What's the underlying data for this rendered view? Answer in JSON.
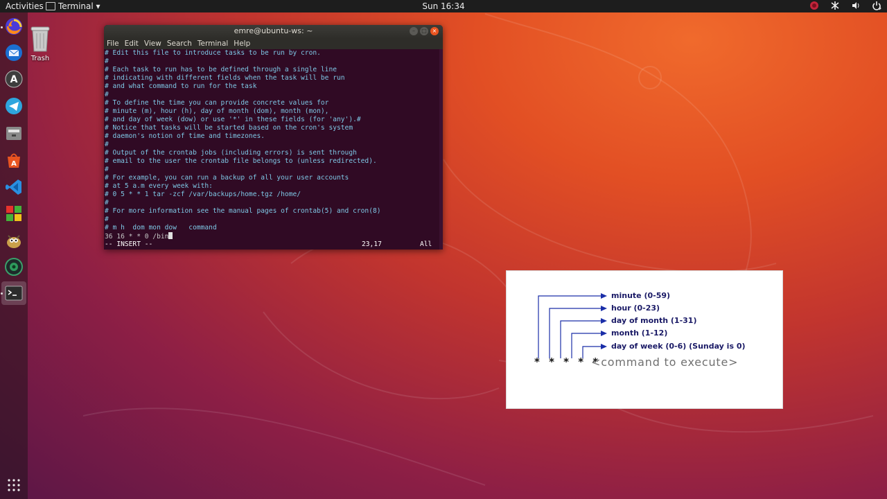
{
  "topbar": {
    "activities": "Activities",
    "app_name": "Terminal ▾",
    "clock": "Sun 16:34",
    "tray_icons": [
      "recording-icon",
      "network-icon",
      "volume-icon",
      "power-icon"
    ]
  },
  "dock": {
    "apps": [
      "firefox-icon",
      "thunderbird-icon",
      "software-updater-icon",
      "telegram-icon",
      "files-icon",
      "ubuntu-software-icon",
      "vscode-icon",
      "blocks-game-icon",
      "gimp-icon",
      "browser-globe-icon",
      "terminal-icon"
    ]
  },
  "desktop": {
    "trash_label": "Trash"
  },
  "terminal": {
    "title": "emre@ubuntu-ws: ~",
    "menu": [
      "File",
      "Edit",
      "View",
      "Search",
      "Terminal",
      "Help"
    ],
    "lines": [
      "# Edit this file to introduce tasks to be run by cron.",
      "#",
      "# Each task to run has to be defined through a single line",
      "# indicating with different fields when the task will be run",
      "# and what command to run for the task",
      "#",
      "# To define the time you can provide concrete values for",
      "# minute (m), hour (h), day of month (dom), month (mon),",
      "# and day of week (dow) or use '*' in these fields (for 'any').#",
      "# Notice that tasks will be started based on the cron's system",
      "# daemon's notion of time and timezones.",
      "#",
      "# Output of the crontab jobs (including errors) is sent through",
      "# email to the user the crontab file belongs to (unless redirected).",
      "#",
      "# For example, you can run a backup of all your user accounts",
      "# at 5 a.m every week with:",
      "# 0 5 * * 1 tar -zcf /var/backups/home.tgz /home/",
      "#",
      "# For more information see the manual pages of crontab(5) and cron(8)",
      "#",
      "# m h  dom mon dow   command"
    ],
    "edit_line": "36 16 * * 0 /bin",
    "mode": "-- INSERT --",
    "position": "23,17",
    "scroll": "All"
  },
  "diagram": {
    "fields": [
      "minute (0-59)",
      "hour (0-23)",
      "day of month (1-31)",
      "month (1-12)",
      "day of week (0-6) (Sunday is 0)"
    ],
    "stars": "* * * * *",
    "command": "<command to execute>"
  },
  "colors": {
    "terminal_bg": "#300a24",
    "terminal_text": "#7ec8e6",
    "accent": "#e95420",
    "diagram_text": "#1a1a66"
  }
}
